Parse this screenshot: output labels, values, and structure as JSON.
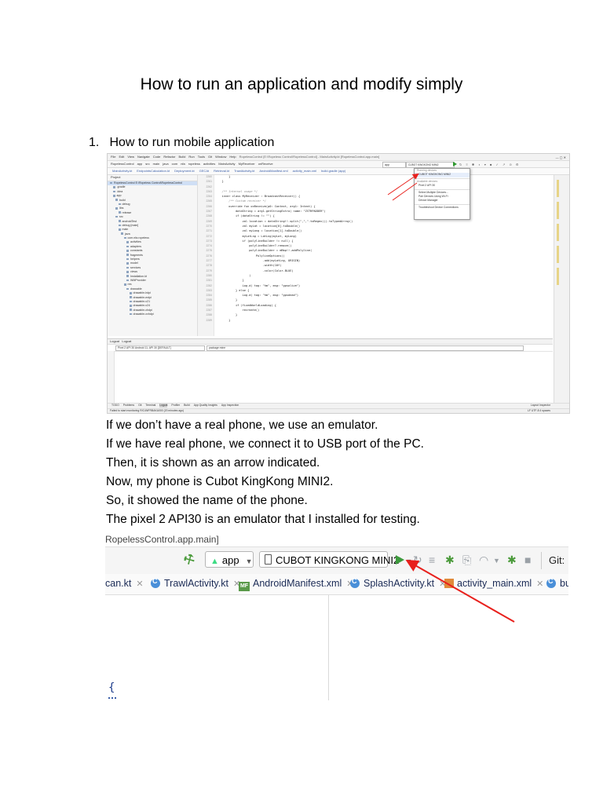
{
  "title": "How to run an application and modify simply",
  "section": {
    "number": "1.",
    "text": "How to run mobile application"
  },
  "ide": {
    "window_title": "RopelessControl [E:\\Ropeless Control\\RopelessControl] - MainActivity.kt [RopelessControl.app.main]",
    "menu": [
      "File",
      "Edit",
      "View",
      "Navigate",
      "Code",
      "Refactor",
      "Build",
      "Run",
      "Tools",
      "Git",
      "Window",
      "Help"
    ],
    "breadcrumbs": [
      "RopelessControl",
      "app",
      "src",
      "main",
      "java",
      "com",
      "nfa",
      "ropeless",
      "activities",
      "MainActivity",
      "MyReceiver",
      "onReceive"
    ],
    "run_config": "app",
    "device": "CUBOT KINGKONG MINI2",
    "editor_tabs": [
      "MainActivity.kt",
      "EndpointsCalculation.kt",
      "Deployment.kt",
      "GECAt",
      "Retrieval.kt",
      "TrawlActivity.kt",
      "AndroidManifest.xml",
      "activity_main.xml",
      "build.gradle (app)"
    ],
    "project_panel_title": "Project",
    "tree": [
      "RopelessControl  E:\\Ropeless Control\\RopelessControl",
      ".gradle",
      ".idea",
      "app",
      "build",
      "debug",
      "libs",
      "release",
      "src",
      "androidTest",
      "debug [main]",
      "main",
      "java",
      "com.nfa.ropeless",
      "activities",
      "adapters",
      "constants",
      "fragments",
      "helpers",
      "model",
      "services",
      "views",
      "Installation.kt",
      "WMProvider",
      "res",
      "drawable",
      "drawable-hdpi",
      "drawable-mdpi",
      "drawable-v21",
      "drawable-v24",
      "drawable-xhdpi",
      "drawable-xxhdpi"
    ],
    "code": [
      "        }",
      "    }",
      "",
      "    /** Internal usage */",
      "    inner class MyReceiver : BroadcastReceiver() {",
      "        /** Custom receiver */",
      "        override fun onReceive(p0: Context, arg1: Intent) {",
      "            dataString = arg1.getStringExtra( name: \"ZSTRPADDER\")",
      "            if (dataString != \"\") {",
      "                val location = dataString!!.split(\",\",\".toRegex()).toTypedArray()",
      "                val myLat = location[0].toDouble()",
      "                val myLong = location[1].toDouble()",
      "                myLatLng = LatLng(myLat, myLong)",
      "                if (polylineBuilder != null) {",
      "                    polylineBuilder?.remove()",
      "                    polylineBuilder = mMap!!.addPolyline(",
      "                        PolylineOptions()",
      "                            .add(myLatLng, ORIGIN)",
      "                            .width(10f)",
      "                            .color(Color.BLUE)",
      "                    )",
      "                }",
      "                Log.d( tag: \"hm\", msg: \"gpsalive\")",
      "            } else {",
      "                Log.d( tag: \"hm\", msg: \"gpsdead\")",
      "            }",
      "            if (fixedWorldLoading) {",
      "                recreate()",
      "            }",
      "        }"
    ],
    "dropdown": {
      "group1": "Running devices",
      "device": "CUBOT KINGKONG MINI2",
      "group2": "Available devices",
      "emulator": "Pixel 2 API 30",
      "actions": [
        "Select Multiple Devices...",
        "Pair Devices Using Wi-Fi",
        "Device Manager",
        "Troubleshoot Device Connections"
      ]
    },
    "logcat": {
      "tabs": [
        "Logcat",
        "Logcat"
      ],
      "device_box": "Pixel 2 API 30 Android 11, API 30 [DEFAULT]",
      "filter": "package:mine"
    },
    "bottom_tools": [
      "TODO",
      "Problems",
      "Git",
      "Terminal",
      "Logcat",
      "Profiler",
      "Build",
      "App Quality Insights",
      "App Inspection",
      "Layout Inspector"
    ],
    "status_left": "Failed to start monitoring R/C4NFRBAKA000 (20 minutes ago)",
    "status_right": "LF  UTF-8  4 spaces"
  },
  "paragraphs": [
    "If we don’t have a real phone, we use an emulator.",
    "If we have real phone, we connect it to USB port of the PC.",
    "Then, it is shown as an arrow indicated.",
    "Now, my phone is Cubot KingKong MINI2.",
    "So, it showed the name of the phone.",
    "The pixel 2 API30 is an emulator that I installed for testing."
  ],
  "zoom": {
    "path_fragment": "RopelessControl.app.main]",
    "run_config": "app",
    "device": "CUBOT KINGKONG MINI2",
    "git_label": "Git:",
    "tabs": [
      "can.kt",
      "TrawlActivity.kt",
      "AndroidManifest.xml",
      "SplashActivity.kt",
      "activity_main.xml",
      "bu"
    ],
    "brace": "{"
  },
  "arrow_color": "#e8201c"
}
